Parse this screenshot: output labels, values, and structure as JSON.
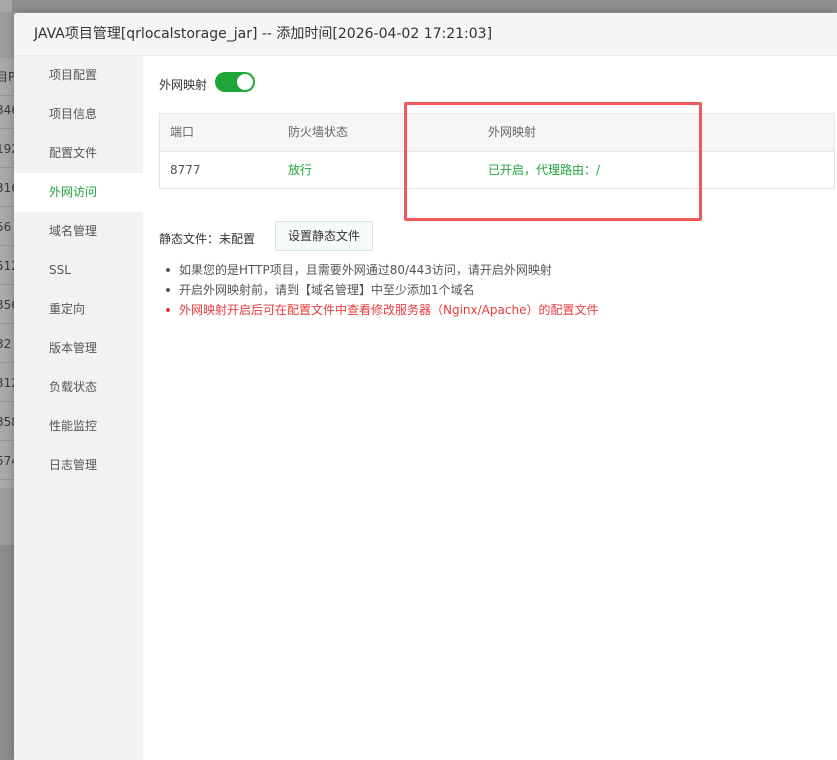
{
  "background": {
    "header_fragment": "目P",
    "row_fragments": [
      "346",
      "192",
      "316",
      "56",
      "512",
      "356",
      "32",
      "312",
      "358",
      "574"
    ]
  },
  "modal": {
    "title": "JAVA项目管理[qrlocalstorage_jar] -- 添加时间[2026-04-02 17:21:03]"
  },
  "sidebar": {
    "items": [
      {
        "label": "项目配置"
      },
      {
        "label": "项目信息"
      },
      {
        "label": "配置文件"
      },
      {
        "label": "外网访问",
        "active": true
      },
      {
        "label": "域名管理"
      },
      {
        "label": "SSL"
      },
      {
        "label": "重定向"
      },
      {
        "label": "版本管理"
      },
      {
        "label": "负载状态"
      },
      {
        "label": "性能监控"
      },
      {
        "label": "日志管理"
      }
    ]
  },
  "content": {
    "mapping_toggle_label": "外网映射",
    "mapping_enabled": true,
    "table": {
      "headers": [
        "端口",
        "防火墙状态",
        "外网映射"
      ],
      "rows": [
        {
          "port": "8777",
          "firewall": "放行",
          "mapping": "已开启，代理路由：/"
        }
      ]
    },
    "static_files_label": "静态文件：未配置",
    "static_files_button": "设置静态文件",
    "tips": [
      "如果您的是HTTP项目，且需要外网通过80/443访问，请开启外网映射",
      "开启外网映射前，请到【域名管理】中至少添加1个域名",
      "外网映射开启后可在配置文件中查看修改服务器（Nginx/Apache）的配置文件"
    ]
  },
  "colors": {
    "accent": "#20a53a",
    "warning": "#e63b3b",
    "highlight_box": "#f0595c"
  }
}
